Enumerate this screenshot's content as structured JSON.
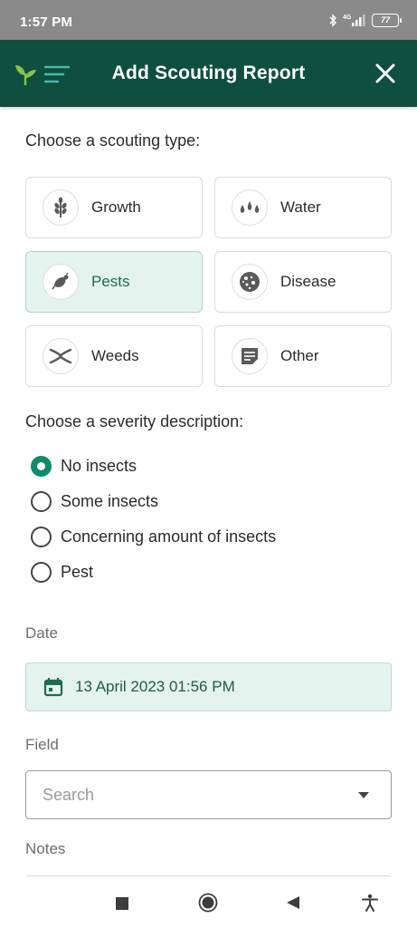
{
  "status_bar": {
    "time": "1:57 PM",
    "network": "4G",
    "battery": "77"
  },
  "header": {
    "title": "Add Scouting Report",
    "logo_icon": "sprout-menu-icon",
    "close_icon": "close-icon"
  },
  "scouting": {
    "prompt": "Choose a scouting type:",
    "types": [
      {
        "label": "Growth",
        "icon": "wheat-icon",
        "selected": false
      },
      {
        "label": "Water",
        "icon": "water-drops-icon",
        "selected": false
      },
      {
        "label": "Pests",
        "icon": "bug-icon",
        "selected": true
      },
      {
        "label": "Disease",
        "icon": "disease-icon",
        "selected": false
      },
      {
        "label": "Weeds",
        "icon": "weeds-icon",
        "selected": false
      },
      {
        "label": "Other",
        "icon": "note-icon",
        "selected": false
      }
    ]
  },
  "severity": {
    "prompt": "Choose a severity description:",
    "options": [
      {
        "label": "No insects",
        "checked": true
      },
      {
        "label": "Some insects",
        "checked": false
      },
      {
        "label": "Concerning amount of insects",
        "checked": false
      },
      {
        "label": "Pest",
        "checked": false
      }
    ]
  },
  "date": {
    "label": "Date",
    "value": "13 April 2023 01:56 PM",
    "icon": "calendar-icon"
  },
  "field": {
    "label": "Field",
    "placeholder": "Search",
    "icon": "dropdown-arrow-icon"
  },
  "notes": {
    "label": "Notes"
  },
  "nav": {
    "icons": [
      "recents-square-icon",
      "home-circle-icon",
      "back-triangle-icon",
      "accessibility-icon"
    ]
  },
  "colors": {
    "header_bg": "#0f4f3f",
    "accent": "#0f8a6a",
    "selected_bg": "#e5f3ee"
  }
}
